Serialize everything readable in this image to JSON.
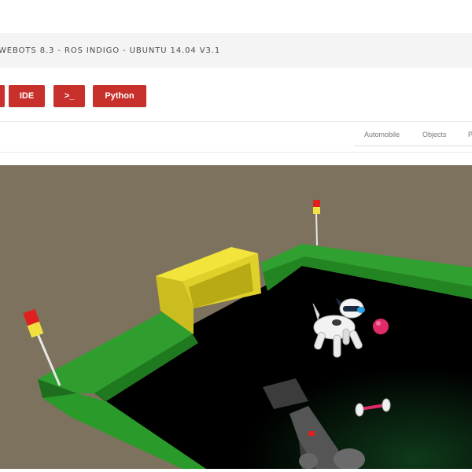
{
  "header": {
    "title": "WEBOTS 8.3 - ROS INDIGO - UBUNTU 14.04 V3.1"
  },
  "toolbar": {
    "buttons": [
      {
        "label": ""
      },
      {
        "label": "IDE"
      },
      {
        "label": ">_"
      },
      {
        "label": "Python"
      }
    ],
    "button_color": "#c8302b"
  },
  "tabs": [
    {
      "label": "Automobile"
    },
    {
      "label": "Objects"
    },
    {
      "label": "P"
    }
  ],
  "scene": {
    "background": "#7d725d",
    "floor": "#000000",
    "walls": "#2f9e2f",
    "goal": "#e6d82a",
    "ball": "#e02a6a",
    "robot": "aibo-robot-dog"
  }
}
